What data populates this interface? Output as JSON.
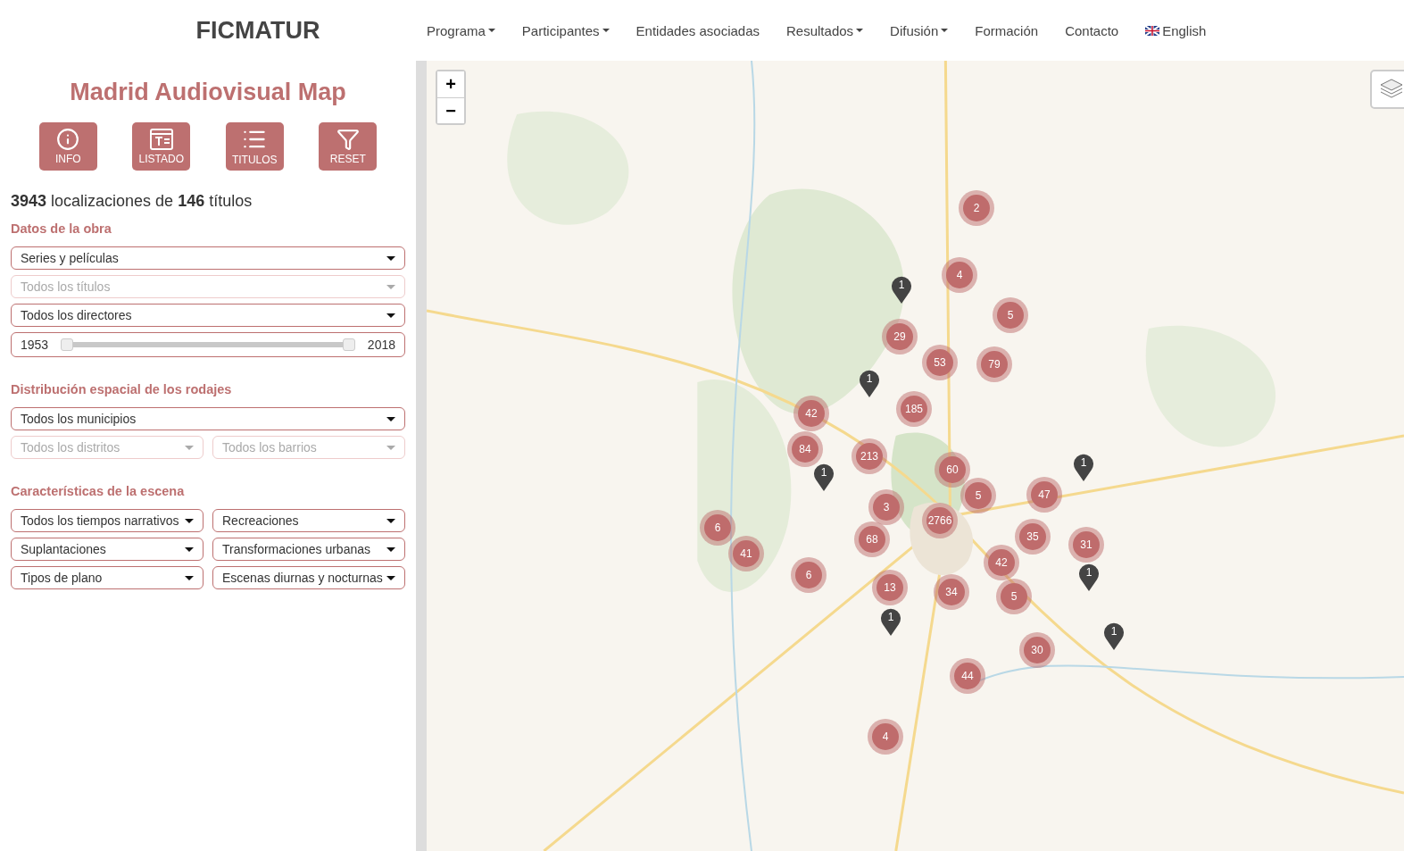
{
  "header": {
    "brand": "FICMATUR",
    "nav": [
      {
        "label": "Programa",
        "dropdown": true,
        "kind": "text"
      },
      {
        "label": "Participantes",
        "dropdown": true,
        "kind": "text"
      },
      {
        "label": "Entidades asociadas",
        "dropdown": false,
        "kind": "text"
      },
      {
        "label": "Resultados",
        "dropdown": true,
        "kind": "text"
      },
      {
        "label": "Difusión",
        "dropdown": true,
        "kind": "text"
      },
      {
        "label": "Formación",
        "dropdown": false,
        "kind": "text"
      },
      {
        "label": "Contacto",
        "dropdown": false,
        "kind": "text"
      },
      {
        "label": "English",
        "dropdown": false,
        "kind": "language"
      }
    ]
  },
  "sidebar": {
    "title": "Madrid Audiovisual Map",
    "buttons": [
      {
        "label": "INFO",
        "kind": "info"
      },
      {
        "label": "LISTADO",
        "kind": "list"
      },
      {
        "label": "TITULOS",
        "kind": "titles"
      },
      {
        "label": "RESET",
        "kind": "reset"
      }
    ],
    "summary": "**3943** localizaciones de **146** títulos",
    "sections": [
      {
        "heading": "Datos de la obra",
        "rows": [
          [
            {
              "kind": "select",
              "value": "Series y películas",
              "disabled": false
            }
          ],
          [
            {
              "kind": "select",
              "placeholder": "Todos los títulos",
              "disabled": true
            }
          ],
          [
            {
              "kind": "select",
              "value": "Todos los directores",
              "disabled": false
            }
          ],
          [
            {
              "kind": "range",
              "min": "1953",
              "max": "2018",
              "level": 1
            }
          ]
        ]
      },
      {
        "heading": "Distribución espacial de los rodajes",
        "rows": [
          [
            {
              "kind": "select",
              "value": "Todos los municipios",
              "disabled": false
            }
          ],
          [
            {
              "kind": "select",
              "placeholder": "Todos los distritos",
              "disabled": true
            },
            {
              "kind": "select",
              "placeholder": "Todos los barrios",
              "disabled": true
            }
          ]
        ]
      },
      {
        "heading": "Características de la escena",
        "rows": [
          [
            {
              "kind": "select",
              "value": "Todos los tiempos narrativos",
              "disabled": false
            },
            {
              "kind": "select",
              "value": "Recreaciones",
              "disabled": false
            }
          ],
          [
            {
              "kind": "select",
              "value": "Suplantaciones",
              "disabled": false
            },
            {
              "kind": "select",
              "value": "Transformaciones urbanas",
              "disabled": false
            }
          ],
          [
            {
              "kind": "select",
              "value": "Tipos de plano",
              "disabled": false
            },
            {
              "kind": "select",
              "value": "Escenas diurnas y nocturnas",
              "disabled": false
            }
          ]
        ]
      }
    ]
  },
  "map": {
    "kind": "picture",
    "zoom_in": "+",
    "zoom_out": "−",
    "markers": [
      {
        "kind": "cluster",
        "count": "2"
      },
      {
        "kind": "cluster",
        "count": "4"
      },
      {
        "kind": "cluster",
        "count": "5"
      },
      {
        "kind": "cluster",
        "count": "29"
      },
      {
        "kind": "cluster",
        "count": "53"
      },
      {
        "kind": "cluster",
        "count": "79"
      },
      {
        "kind": "cluster",
        "count": "185"
      },
      {
        "kind": "cluster",
        "count": "42"
      },
      {
        "kind": "cluster",
        "count": "84"
      },
      {
        "kind": "cluster",
        "count": "213"
      },
      {
        "kind": "cluster",
        "count": "60"
      },
      {
        "kind": "cluster",
        "count": "5"
      },
      {
        "kind": "cluster",
        "count": "47"
      },
      {
        "kind": "cluster",
        "count": "3"
      },
      {
        "kind": "cluster",
        "count": "2766"
      },
      {
        "kind": "cluster",
        "count": "6"
      },
      {
        "kind": "cluster",
        "count": "68"
      },
      {
        "kind": "cluster",
        "count": "35"
      },
      {
        "kind": "cluster",
        "count": "31"
      },
      {
        "kind": "cluster",
        "count": "41"
      },
      {
        "kind": "cluster",
        "count": "42"
      },
      {
        "kind": "cluster",
        "count": "6"
      },
      {
        "kind": "cluster",
        "count": "13"
      },
      {
        "kind": "cluster",
        "count": "34"
      },
      {
        "kind": "cluster",
        "count": "5"
      },
      {
        "kind": "cluster",
        "count": "30"
      },
      {
        "kind": "cluster",
        "count": "44"
      },
      {
        "kind": "cluster",
        "count": "4"
      },
      {
        "kind": "pin",
        "count": "1"
      },
      {
        "kind": "pin",
        "count": "1"
      },
      {
        "kind": "pin",
        "count": "1"
      },
      {
        "kind": "pin",
        "count": "1"
      },
      {
        "kind": "pin",
        "count": "1"
      },
      {
        "kind": "pin",
        "count": "1"
      },
      {
        "kind": "pin",
        "count": "1"
      }
    ]
  }
}
